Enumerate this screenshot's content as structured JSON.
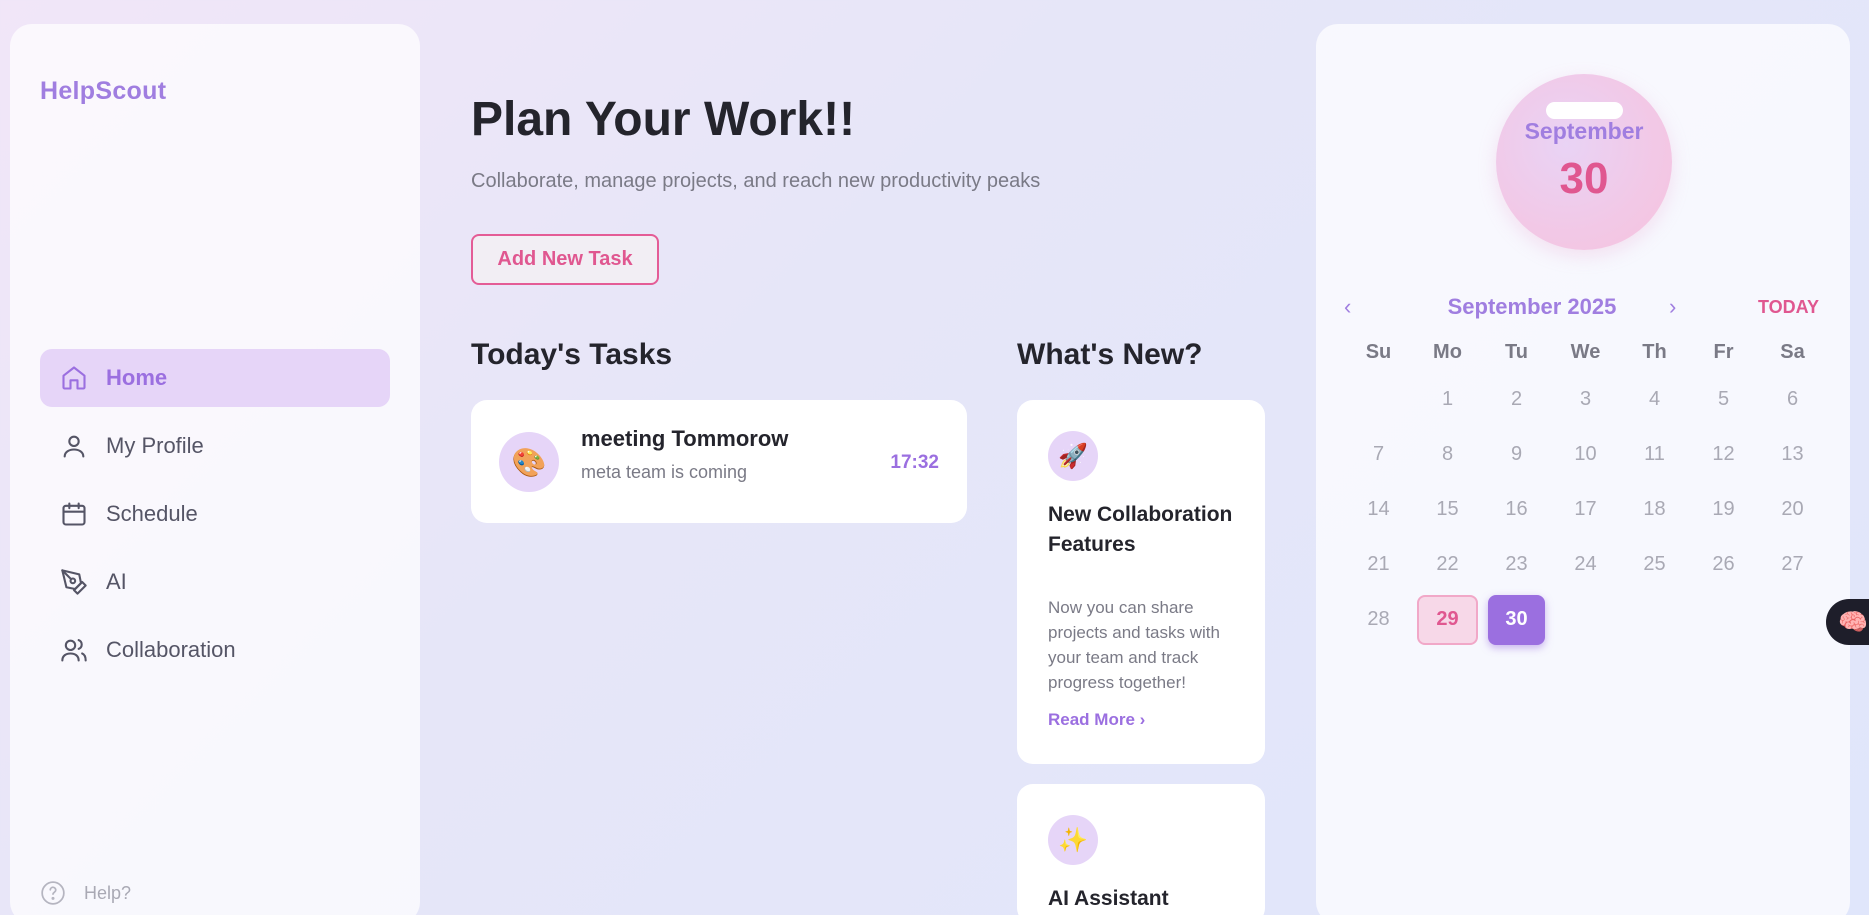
{
  "sidebar": {
    "brand": "HelpScout",
    "items": [
      {
        "label": "Home",
        "icon": "home-icon"
      },
      {
        "label": "My Profile",
        "icon": "user-icon"
      },
      {
        "label": "Schedule",
        "icon": "calendar-icon"
      },
      {
        "label": "AI",
        "icon": "pen-tool-icon"
      },
      {
        "label": "Collaboration",
        "icon": "users-icon"
      }
    ],
    "help": "Help?"
  },
  "main": {
    "title": "Plan Your Work!!",
    "subtitle": "Collaborate, manage projects, and reach new productivity peaks",
    "add_button": "Add New Task",
    "tasks_title": "Today's Tasks",
    "tasks": [
      {
        "title": "meeting Tommorow",
        "desc": "meta team is coming",
        "time": "17:32",
        "icon": "🎨"
      }
    ],
    "news_title": "What's New?",
    "news": [
      {
        "icon": "🚀",
        "title": "New Collaboration Features",
        "desc": "Now you can share projects and tasks with your team and track progress together!",
        "link": "Read More ›"
      },
      {
        "icon": "✨",
        "title": "AI Assistant"
      }
    ]
  },
  "calendar": {
    "badge_month": "September",
    "badge_day": "30",
    "prev": "‹",
    "month_title": "September 2025",
    "next": "›",
    "today": "TODAY",
    "dow": [
      "Su",
      "Mo",
      "Tu",
      "We",
      "Th",
      "Fr",
      "Sa"
    ],
    "weeks": [
      [
        "",
        "1",
        "2",
        "3",
        "4",
        "5",
        "6"
      ],
      [
        "7",
        "8",
        "9",
        "10",
        "11",
        "12",
        "13"
      ],
      [
        "14",
        "15",
        "16",
        "17",
        "18",
        "19",
        "20"
      ],
      [
        "21",
        "22",
        "23",
        "24",
        "25",
        "26",
        "27"
      ],
      [
        "28",
        "29",
        "30",
        "",
        "",
        "",
        ""
      ]
    ]
  },
  "floating": {
    "icon": "🧠"
  },
  "colors": {
    "accent": "#9b6fe0",
    "pink": "#e05790",
    "active_bg": "#e6d5f8"
  }
}
